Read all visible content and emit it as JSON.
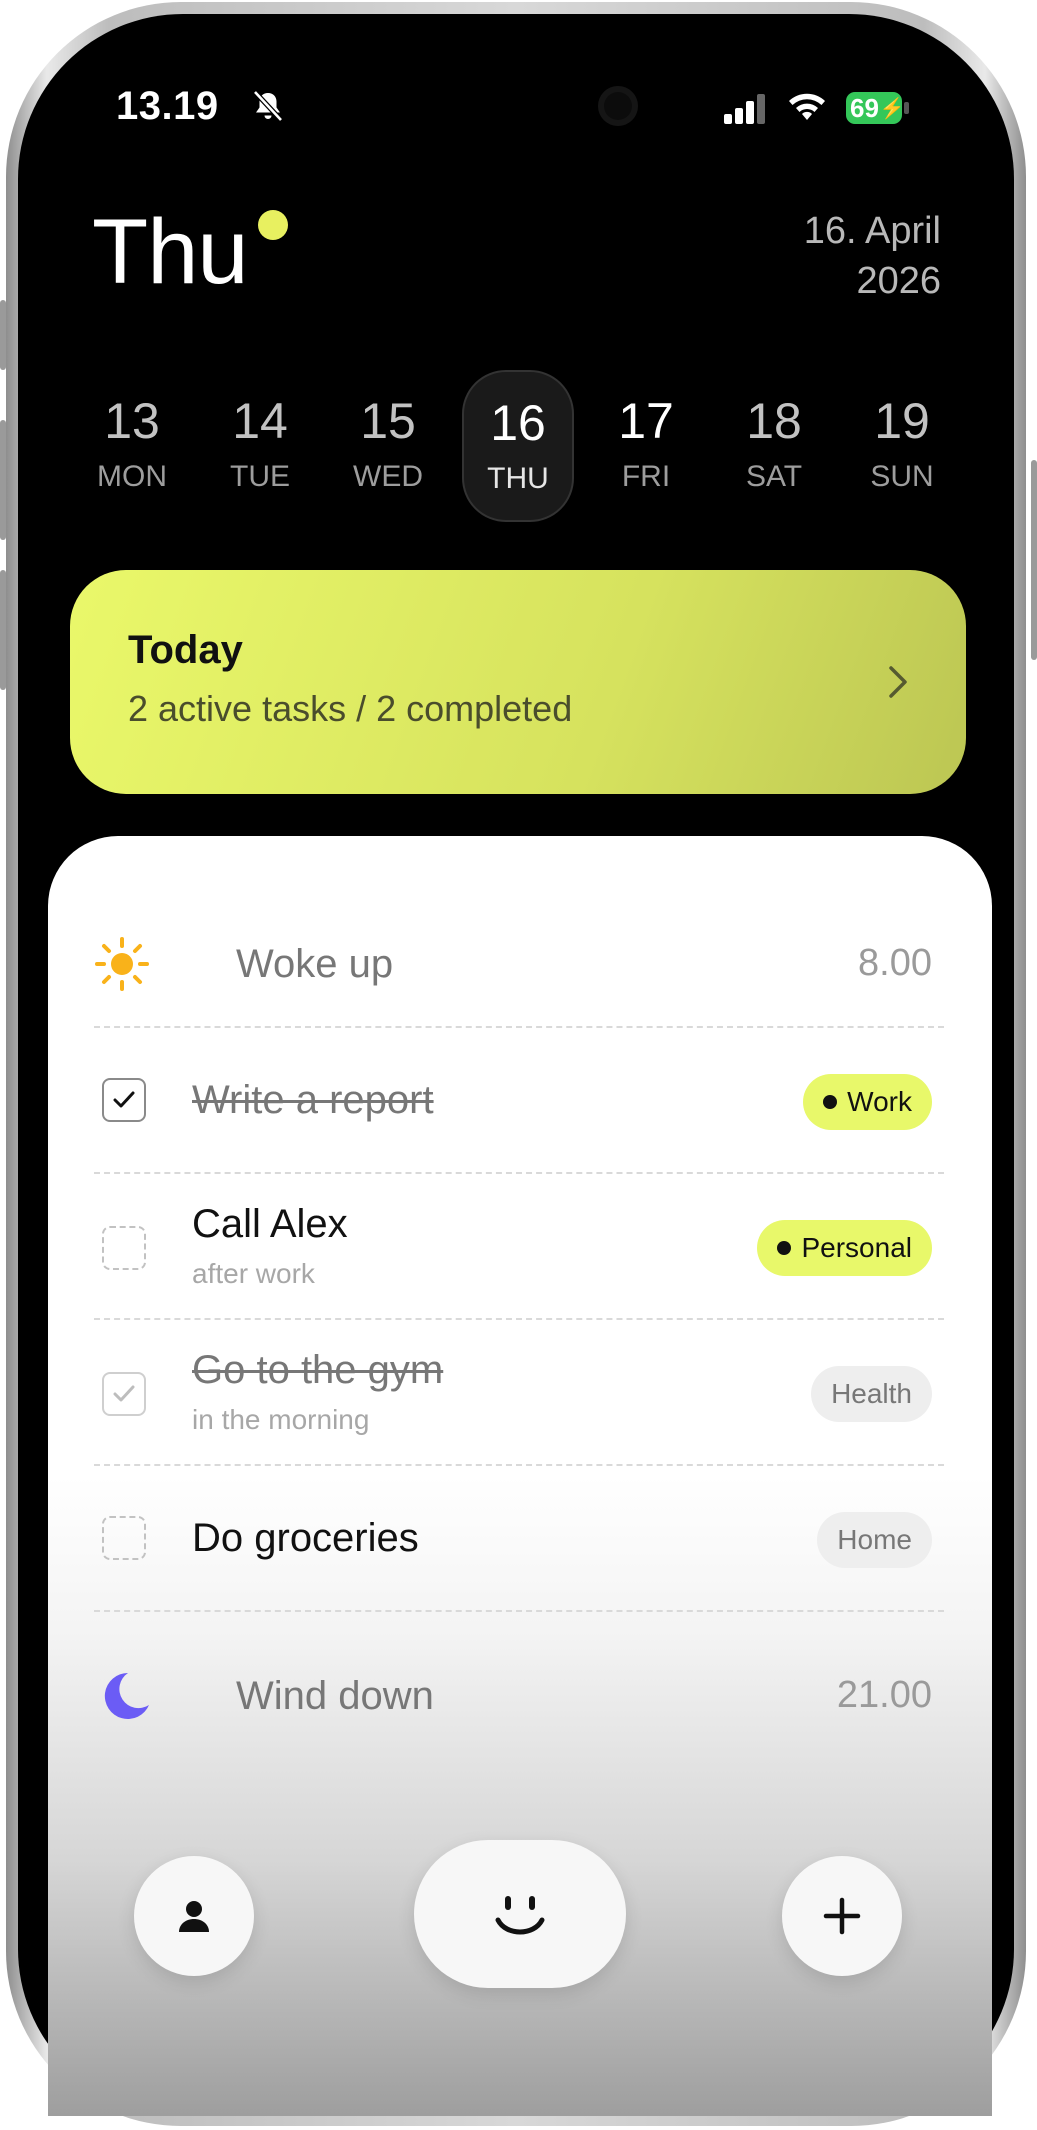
{
  "status_bar": {
    "time": "13.19",
    "battery": "69"
  },
  "header": {
    "day": "Thu",
    "date_line1": "16. April",
    "date_line2": "2026",
    "accent_color": "#e8f060"
  },
  "week": [
    {
      "num": "13",
      "dow": "MON"
    },
    {
      "num": "14",
      "dow": "TUE"
    },
    {
      "num": "15",
      "dow": "WED"
    },
    {
      "num": "16",
      "dow": "THU",
      "selected": true
    },
    {
      "num": "17",
      "dow": "FRI"
    },
    {
      "num": "18",
      "dow": "SAT"
    },
    {
      "num": "19",
      "dow": "SUN"
    }
  ],
  "today_card": {
    "title": "Today",
    "subtitle": "2 active tasks / 2 completed",
    "icon": "chevron-right-icon"
  },
  "timeline": {
    "start": {
      "icon": "sun-icon",
      "label": "Woke up",
      "time": "8.00"
    },
    "tasks": [
      {
        "title": "Write a report",
        "subtitle": "",
        "done": true,
        "tag": "Work"
      },
      {
        "title": "Call Alex",
        "subtitle": "after work",
        "done": false,
        "tag": "Personal"
      },
      {
        "title": "Go to the gym",
        "subtitle": "in the morning",
        "done": true,
        "tag": "Health"
      },
      {
        "title": "Do groceries",
        "subtitle": "",
        "done": false,
        "tag": "Home"
      }
    ],
    "end": {
      "icon": "moon-icon",
      "label": "Wind down",
      "time": "21.00"
    }
  },
  "bottom_nav": {
    "left_icon": "person-icon",
    "center_icon": "smiley-icon",
    "right_icon": "plus-icon"
  },
  "colors": {
    "lime": "#e8f86a",
    "sun": "#f9b21a",
    "moon": "#6b5cf5",
    "battery": "#34c759"
  }
}
